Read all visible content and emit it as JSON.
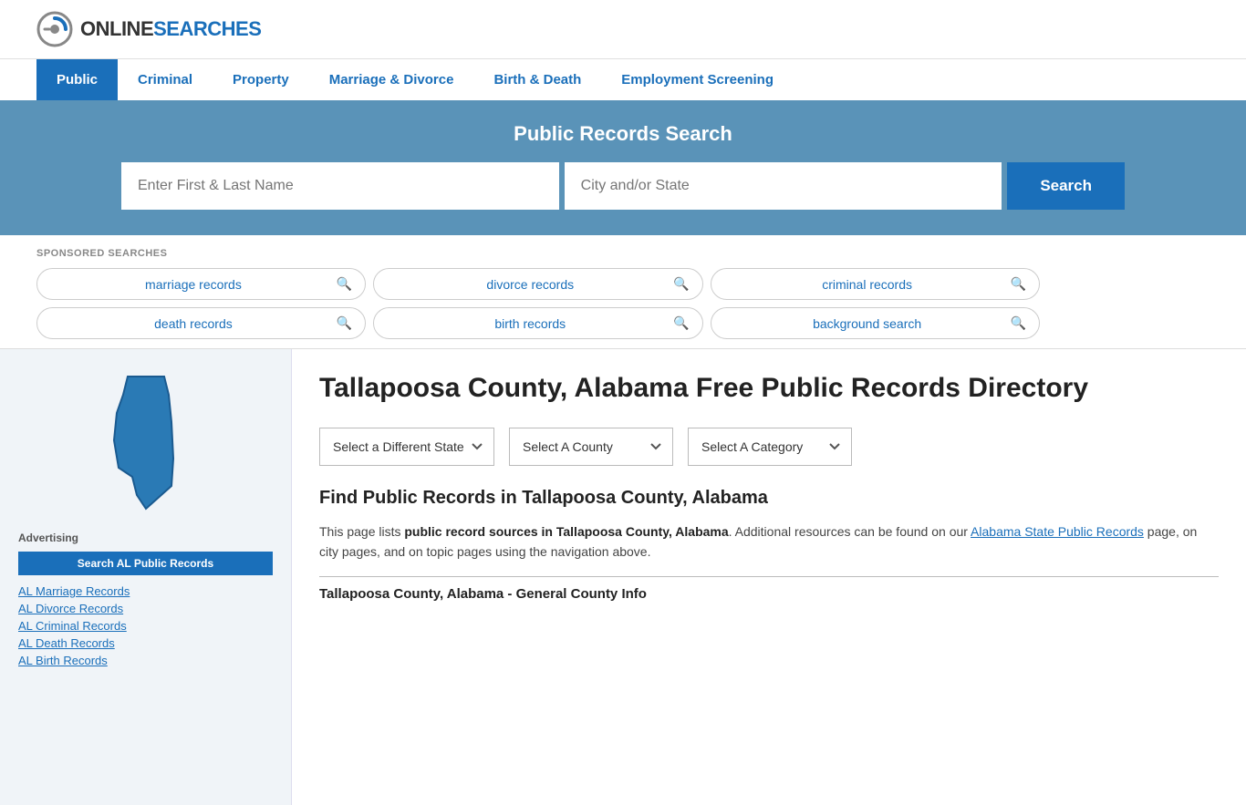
{
  "header": {
    "logo_online": "ONLINE",
    "logo_searches": "SEARCHES"
  },
  "nav": {
    "items": [
      {
        "label": "Public",
        "active": true
      },
      {
        "label": "Criminal",
        "active": false
      },
      {
        "label": "Property",
        "active": false
      },
      {
        "label": "Marriage & Divorce",
        "active": false
      },
      {
        "label": "Birth & Death",
        "active": false
      },
      {
        "label": "Employment Screening",
        "active": false
      }
    ]
  },
  "search_banner": {
    "title": "Public Records Search",
    "name_placeholder": "Enter First & Last Name",
    "location_placeholder": "City and/or State",
    "button_label": "Search"
  },
  "sponsored": {
    "label": "SPONSORED SEARCHES",
    "pills": [
      {
        "text": "marriage records"
      },
      {
        "text": "divorce records"
      },
      {
        "text": "criminal records"
      },
      {
        "text": "death records"
      },
      {
        "text": "birth records"
      },
      {
        "text": "background search"
      }
    ]
  },
  "sidebar": {
    "advertising_label": "Advertising",
    "ad_button": "Search AL Public Records",
    "links": [
      {
        "label": "AL Marriage Records"
      },
      {
        "label": "AL Divorce Records"
      },
      {
        "label": "AL Criminal Records"
      },
      {
        "label": "AL Death Records"
      },
      {
        "label": "AL Birth Records"
      }
    ]
  },
  "content": {
    "page_title": "Tallapoosa County, Alabama Free Public Records Directory",
    "dropdowns": {
      "state_label": "Select a Different State",
      "county_label": "Select A County",
      "category_label": "Select A Category"
    },
    "find_title": "Find Public Records in Tallapoosa County, Alabama",
    "find_text_1": "This page lists ",
    "find_text_bold": "public record sources in Tallapoosa County, Alabama",
    "find_text_2": ". Additional resources can be found on our ",
    "find_link": "Alabama State Public Records",
    "find_text_3": " page, on city pages, and on topic pages using the navigation above.",
    "county_info_title": "Tallapoosa County, Alabama - General County Info"
  }
}
